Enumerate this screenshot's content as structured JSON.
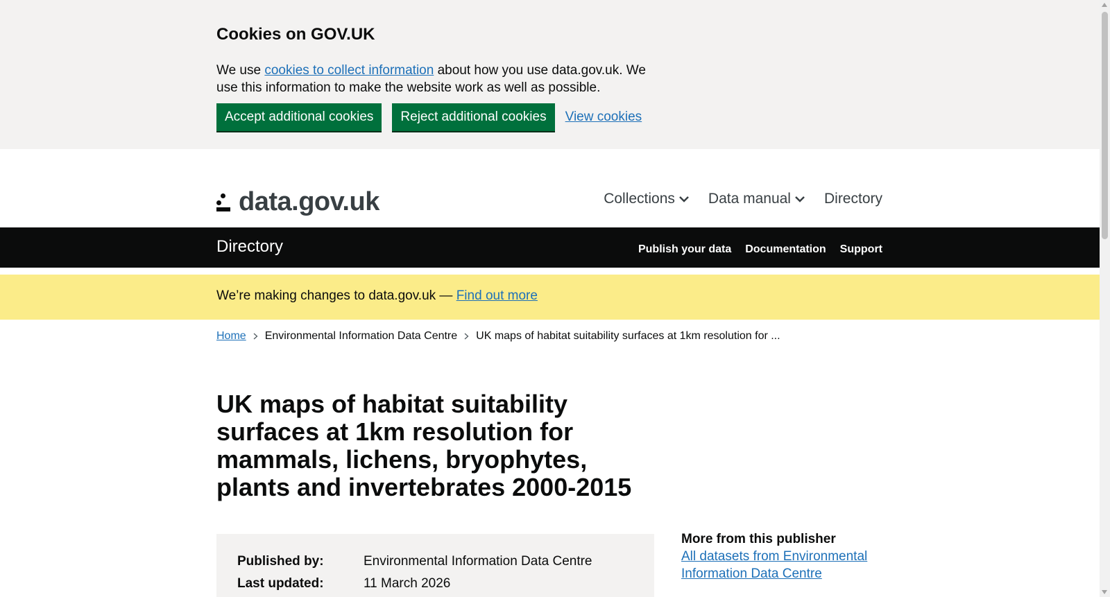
{
  "cookie_banner": {
    "title": "Cookies on GOV.UK",
    "text_before_link": "We use ",
    "link_text": "cookies to collect information",
    "text_after_link": " about how you use data.gov.uk. We use this information to make the website work as well as possible.",
    "accept_label": "Accept additional cookies",
    "reject_label": "Reject additional cookies",
    "view_label": "View cookies"
  },
  "header": {
    "logo_text": "data.gov.uk",
    "nav": [
      "Collections",
      "Data manual",
      "Directory"
    ]
  },
  "directory_bar": {
    "title": "Directory",
    "links": [
      "Publish your data",
      "Documentation",
      "Support"
    ]
  },
  "notice": {
    "text": "We’re making changes to data.gov.uk — ",
    "link": "Find out more"
  },
  "breadcrumbs": [
    "Home",
    "Environmental Information Data Centre",
    "UK maps of habitat suitability surfaces at 1km resolution for ..."
  ],
  "page_title": "UK maps of habitat suitability surfaces at 1km resolution for mammals, lichens, bryophytes, plants and invertebrates 2000-2015",
  "metadata": {
    "published_by_label": "Published by:",
    "published_by_value": "Environmental Information Data Centre",
    "last_updated_label": "Last updated:",
    "last_updated_value": "11 March 2026"
  },
  "sidebar": {
    "title": "More from this publisher",
    "link": "All datasets from Environmental Information Data Centre"
  },
  "colors": {
    "govuk_green": "#00703c",
    "link_blue": "#1d70b8",
    "notice_yellow": "#fbec89",
    "banner_grey": "#f3f2f1",
    "black": "#0b0c0c"
  }
}
